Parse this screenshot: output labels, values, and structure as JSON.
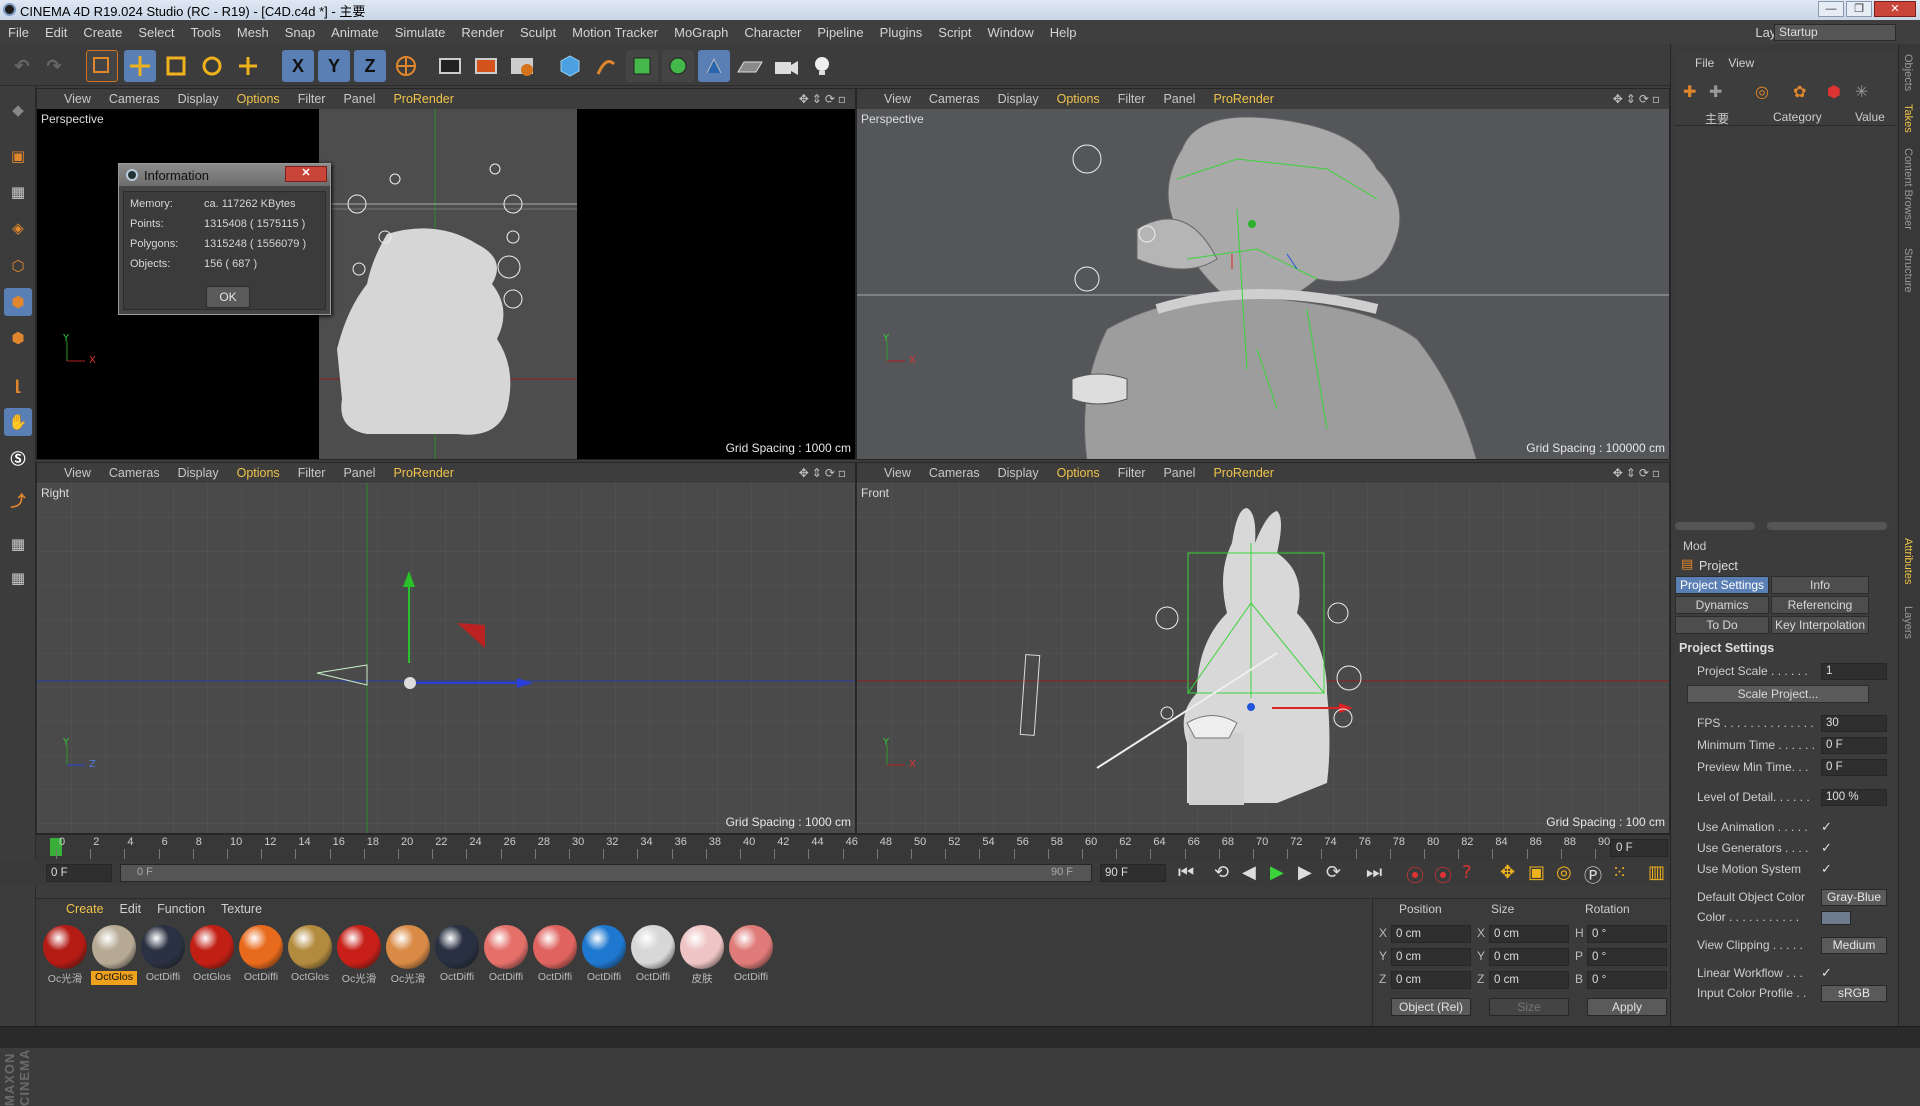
{
  "window": {
    "title": "CINEMA 4D R19.024 Studio (RC - R19) - [C4D.c4d *] - 主要",
    "minimize": "—",
    "maximize": "❐",
    "close": "✕"
  },
  "menubar": [
    "File",
    "Edit",
    "Create",
    "Select",
    "Tools",
    "Mesh",
    "Snap",
    "Animate",
    "Simulate",
    "Render",
    "Sculpt",
    "Motion Tracker",
    "MoGraph",
    "Character",
    "Pipeline",
    "Plugins",
    "Script",
    "Window",
    "Help"
  ],
  "layout": {
    "label": "Layout:",
    "value": "Startup"
  },
  "toolbar": {
    "axis_x": "X",
    "axis_y": "Y",
    "axis_z": "Z"
  },
  "viewport_menu": {
    "view": "View",
    "cameras": "Cameras",
    "display": "Display",
    "options": "Options",
    "filter": "Filter",
    "panel": "Panel",
    "prorender": "ProRender"
  },
  "viewports": {
    "top_left": {
      "label": "Perspective",
      "grid": "Grid Spacing : 1000 cm"
    },
    "top_right": {
      "label": "Perspective",
      "grid": "Grid Spacing : 100000 cm"
    },
    "bottom_left": {
      "label": "Right",
      "grid": "Grid Spacing : 1000 cm"
    },
    "bottom_right": {
      "label": "Front",
      "grid": "Grid Spacing : 100 cm"
    }
  },
  "axis_labels": {
    "x": "X",
    "y": "Y",
    "z": "Z"
  },
  "info_dialog": {
    "title": "Information",
    "close": "✕",
    "rows": [
      {
        "label": "Memory:",
        "value": "ca. 117262 KBytes"
      },
      {
        "label": "Points:",
        "value": "1315408 ( 1575115 )"
      },
      {
        "label": "Polygons:",
        "value": "1315248 ( 1556079 )"
      },
      {
        "label": "Objects:",
        "value": "156 ( 687 )"
      }
    ],
    "ok": "OK"
  },
  "timeline": {
    "ticks": [
      "0",
      "2",
      "4",
      "6",
      "8",
      "10",
      "12",
      "14",
      "16",
      "18",
      "20",
      "22",
      "24",
      "26",
      "28",
      "30",
      "32",
      "34",
      "36",
      "38",
      "40",
      "42",
      "44",
      "46",
      "48",
      "50",
      "52",
      "54",
      "56",
      "58",
      "60",
      "62",
      "64",
      "66",
      "68",
      "70",
      "72",
      "74",
      "76",
      "78",
      "80",
      "82",
      "84",
      "86",
      "88",
      "90"
    ],
    "current_frame": "0 F",
    "start_frame": "0 F",
    "range_start": "0 F",
    "range_end": "90 F",
    "end_frame": "90 F"
  },
  "material_manager": {
    "menu": [
      "Create",
      "Edit",
      "Function",
      "Texture"
    ],
    "materials": [
      {
        "label": "Oc光滑",
        "color": "#b41b14"
      },
      {
        "label": "OctGlos",
        "color": "#b7aa95",
        "selected": true
      },
      {
        "label": "OctDiffi",
        "color": "#2a3142"
      },
      {
        "label": "OctGlos",
        "color": "#c21f14"
      },
      {
        "label": "OctDiffi",
        "color": "#e86a1c"
      },
      {
        "label": "OctGlos",
        "color": "#b38b3e"
      },
      {
        "label": "Oc光滑",
        "color": "#c81f18"
      },
      {
        "label": "Oc光滑",
        "color": "#d98a45"
      },
      {
        "label": "OctDiffi",
        "color": "#283042"
      },
      {
        "label": "OctDiffi",
        "color": "#e5706a"
      },
      {
        "label": "OctDiffi",
        "color": "#e0635f"
      },
      {
        "label": "OctDiffi",
        "color": "#1e78d0"
      },
      {
        "label": "OctDiffi",
        "color": "#d7d7d7"
      },
      {
        "label": "皮肤",
        "color": "#efc4c4"
      },
      {
        "label": "OctDiffi",
        "color": "#df7b78"
      }
    ]
  },
  "coordinates": {
    "headers": {
      "position": "Position",
      "size": "Size",
      "rotation": "Rotation"
    },
    "rows": [
      {
        "axis": "X",
        "pos": "0 cm",
        "size_axis": "X",
        "size": "0 cm",
        "rot_axis": "H",
        "rot": "0 °"
      },
      {
        "axis": "Y",
        "pos": "0 cm",
        "size_axis": "Y",
        "size": "0 cm",
        "rot_axis": "P",
        "rot": "0 °"
      },
      {
        "axis": "Z",
        "pos": "0 cm",
        "size_axis": "Z",
        "size": "0 cm",
        "rot_axis": "B",
        "rot": "0 °"
      }
    ],
    "mode": "Object (Rel)",
    "size_mode": "Size",
    "apply": "Apply"
  },
  "object_manager": {
    "menu": [
      "File",
      "View"
    ],
    "item": "主要",
    "columns": {
      "category": "Category",
      "value": "Value"
    }
  },
  "side_tabs": [
    "Objects",
    "Takes",
    "Content Browser",
    "Structure",
    "Attributes",
    "Layers"
  ],
  "attributes": {
    "mode": "Mod",
    "object": "Project",
    "tabs": [
      "Project Settings",
      "Info",
      "Dynamics",
      "Referencing",
      "To Do",
      "Key Interpolation"
    ],
    "section": "Project Settings",
    "project_scale_label": "Project Scale . . . . . .",
    "project_scale": "1",
    "scale_project": "Scale Project...",
    "fps_label": "FPS . . . . . . . . . . . . . .",
    "fps": "30",
    "min_time_label": "Minimum Time . . . . . .",
    "min_time": "0 F",
    "preview_min_label": "Preview Min Time. . .",
    "preview_min": "0 F",
    "lod_label": "Level of Detail. . . . . .",
    "lod": "100 %",
    "use_animation": "Use Animation . . . . .",
    "use_generators": "Use Generators . . . .",
    "use_motion": "Use Motion System",
    "check": "✓",
    "default_color_label": "Default Object Color",
    "default_color": "Gray-Blue",
    "color_label": "Color . . . . . . . . . . .",
    "view_clipping_label": "View Clipping . . . . .",
    "view_clipping": "Medium",
    "linear_workflow": "Linear Workflow . . .",
    "input_color_label": "Input Color Profile . .",
    "input_color": "sRGB"
  }
}
